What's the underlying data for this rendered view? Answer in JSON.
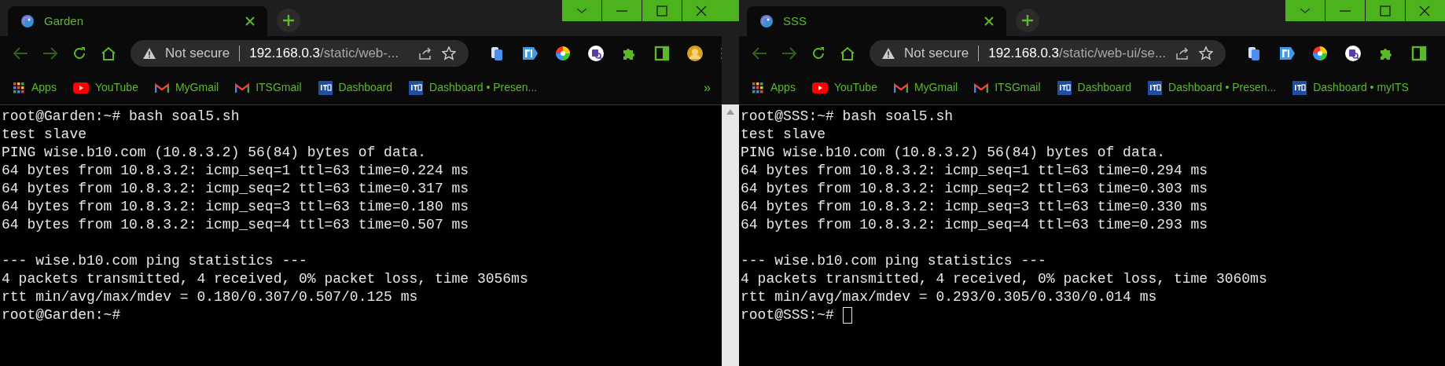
{
  "windows": [
    {
      "tab": {
        "title": "Garden",
        "selected": true
      },
      "address": {
        "security": "Not secure",
        "host": "192.168.0.3",
        "path": "/static/web-..."
      },
      "extensions": [
        {
          "kind": "copy"
        },
        {
          "kind": "fi"
        },
        {
          "kind": "color"
        },
        {
          "kind": "search"
        },
        {
          "kind": "puzzle"
        },
        {
          "kind": "sidebar"
        },
        {
          "kind": "avatar"
        },
        {
          "kind": "menu"
        }
      ],
      "bookmarks": [
        {
          "kind": "apps",
          "label": "Apps"
        },
        {
          "kind": "youtube",
          "label": "YouTube"
        },
        {
          "kind": "gmail",
          "label": "MyGmail"
        },
        {
          "kind": "gmail",
          "label": "ITSGmail"
        },
        {
          "kind": "its",
          "label": "Dashboard"
        },
        {
          "kind": "its",
          "label": "Dashboard • Presen..."
        }
      ],
      "bookmark_overflow": "»",
      "terminal": {
        "cursor": false,
        "blocks": [
          [
            "root@Garden:~# bash soal5.sh",
            "test slave",
            "PING wise.b10.com (10.8.3.2) 56(84) bytes of data.",
            "64 bytes from 10.8.3.2: icmp_seq=1 ttl=63 time=0.224 ms",
            "64 bytes from 10.8.3.2: icmp_seq=2 ttl=63 time=0.317 ms",
            "64 bytes from 10.8.3.2: icmp_seq=3 ttl=63 time=0.180 ms",
            "64 bytes from 10.8.3.2: icmp_seq=4 ttl=63 time=0.507 ms"
          ],
          [
            "--- wise.b10.com ping statistics ---",
            "4 packets transmitted, 4 received, 0% packet loss, time 3056ms",
            "rtt min/avg/max/mdev = 0.180/0.307/0.507/0.125 ms",
            "root@Garden:~#"
          ]
        ]
      }
    },
    {
      "tab": {
        "title": "SSS",
        "selected": true
      },
      "address": {
        "security": "Not secure",
        "host": "192.168.0.3",
        "path": "/static/web-ui/se..."
      },
      "extensions": [
        {
          "kind": "copy"
        },
        {
          "kind": "fi"
        },
        {
          "kind": "color"
        },
        {
          "kind": "search"
        },
        {
          "kind": "puzzle"
        },
        {
          "kind": "sidebar"
        }
      ],
      "bookmarks": [
        {
          "kind": "apps",
          "label": "Apps"
        },
        {
          "kind": "youtube",
          "label": "YouTube"
        },
        {
          "kind": "gmail",
          "label": "MyGmail"
        },
        {
          "kind": "gmail",
          "label": "ITSGmail"
        },
        {
          "kind": "its",
          "label": "Dashboard"
        },
        {
          "kind": "its",
          "label": "Dashboard • Presen..."
        },
        {
          "kind": "its",
          "label": "Dashboard • myITS"
        }
      ],
      "terminal": {
        "cursor": true,
        "blocks": [
          [
            "root@SSS:~# bash soal5.sh",
            "test slave",
            "PING wise.b10.com (10.8.3.2) 56(84) bytes of data.",
            "64 bytes from 10.8.3.2: icmp_seq=1 ttl=63 time=0.294 ms",
            "64 bytes from 10.8.3.2: icmp_seq=2 ttl=63 time=0.303 ms",
            "64 bytes from 10.8.3.2: icmp_seq=3 ttl=63 time=0.330 ms",
            "64 bytes from 10.8.3.2: icmp_seq=4 ttl=63 time=0.293 ms"
          ],
          [
            "--- wise.b10.com ping statistics ---",
            "4 packets transmitted, 4 received, 0% packet loss, time 3060ms",
            "rtt min/avg/max/mdev = 0.293/0.305/0.330/0.014 ms",
            "root@SSS:~#"
          ]
        ]
      }
    }
  ]
}
